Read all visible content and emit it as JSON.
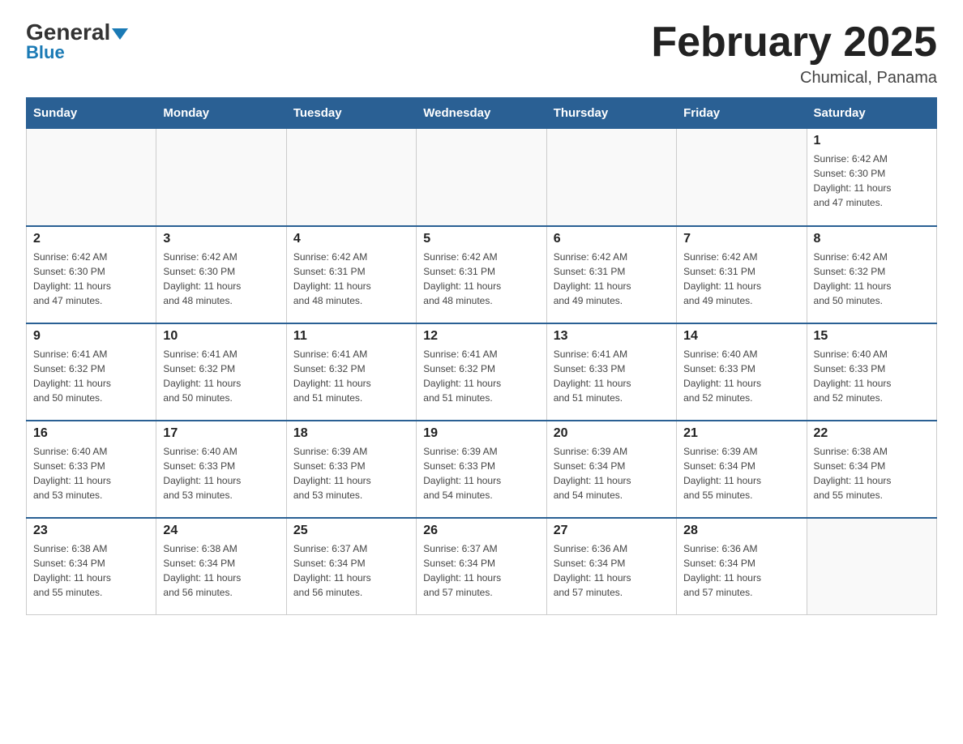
{
  "header": {
    "logo_general": "General",
    "logo_blue": "Blue",
    "month_title": "February 2025",
    "location": "Chumical, Panama"
  },
  "days_of_week": [
    "Sunday",
    "Monday",
    "Tuesday",
    "Wednesday",
    "Thursday",
    "Friday",
    "Saturday"
  ],
  "weeks": [
    [
      {
        "day": "",
        "info": ""
      },
      {
        "day": "",
        "info": ""
      },
      {
        "day": "",
        "info": ""
      },
      {
        "day": "",
        "info": ""
      },
      {
        "day": "",
        "info": ""
      },
      {
        "day": "",
        "info": ""
      },
      {
        "day": "1",
        "info": "Sunrise: 6:42 AM\nSunset: 6:30 PM\nDaylight: 11 hours\nand 47 minutes."
      }
    ],
    [
      {
        "day": "2",
        "info": "Sunrise: 6:42 AM\nSunset: 6:30 PM\nDaylight: 11 hours\nand 47 minutes."
      },
      {
        "day": "3",
        "info": "Sunrise: 6:42 AM\nSunset: 6:30 PM\nDaylight: 11 hours\nand 48 minutes."
      },
      {
        "day": "4",
        "info": "Sunrise: 6:42 AM\nSunset: 6:31 PM\nDaylight: 11 hours\nand 48 minutes."
      },
      {
        "day": "5",
        "info": "Sunrise: 6:42 AM\nSunset: 6:31 PM\nDaylight: 11 hours\nand 48 minutes."
      },
      {
        "day": "6",
        "info": "Sunrise: 6:42 AM\nSunset: 6:31 PM\nDaylight: 11 hours\nand 49 minutes."
      },
      {
        "day": "7",
        "info": "Sunrise: 6:42 AM\nSunset: 6:31 PM\nDaylight: 11 hours\nand 49 minutes."
      },
      {
        "day": "8",
        "info": "Sunrise: 6:42 AM\nSunset: 6:32 PM\nDaylight: 11 hours\nand 50 minutes."
      }
    ],
    [
      {
        "day": "9",
        "info": "Sunrise: 6:41 AM\nSunset: 6:32 PM\nDaylight: 11 hours\nand 50 minutes."
      },
      {
        "day": "10",
        "info": "Sunrise: 6:41 AM\nSunset: 6:32 PM\nDaylight: 11 hours\nand 50 minutes."
      },
      {
        "day": "11",
        "info": "Sunrise: 6:41 AM\nSunset: 6:32 PM\nDaylight: 11 hours\nand 51 minutes."
      },
      {
        "day": "12",
        "info": "Sunrise: 6:41 AM\nSunset: 6:32 PM\nDaylight: 11 hours\nand 51 minutes."
      },
      {
        "day": "13",
        "info": "Sunrise: 6:41 AM\nSunset: 6:33 PM\nDaylight: 11 hours\nand 51 minutes."
      },
      {
        "day": "14",
        "info": "Sunrise: 6:40 AM\nSunset: 6:33 PM\nDaylight: 11 hours\nand 52 minutes."
      },
      {
        "day": "15",
        "info": "Sunrise: 6:40 AM\nSunset: 6:33 PM\nDaylight: 11 hours\nand 52 minutes."
      }
    ],
    [
      {
        "day": "16",
        "info": "Sunrise: 6:40 AM\nSunset: 6:33 PM\nDaylight: 11 hours\nand 53 minutes."
      },
      {
        "day": "17",
        "info": "Sunrise: 6:40 AM\nSunset: 6:33 PM\nDaylight: 11 hours\nand 53 minutes."
      },
      {
        "day": "18",
        "info": "Sunrise: 6:39 AM\nSunset: 6:33 PM\nDaylight: 11 hours\nand 53 minutes."
      },
      {
        "day": "19",
        "info": "Sunrise: 6:39 AM\nSunset: 6:33 PM\nDaylight: 11 hours\nand 54 minutes."
      },
      {
        "day": "20",
        "info": "Sunrise: 6:39 AM\nSunset: 6:34 PM\nDaylight: 11 hours\nand 54 minutes."
      },
      {
        "day": "21",
        "info": "Sunrise: 6:39 AM\nSunset: 6:34 PM\nDaylight: 11 hours\nand 55 minutes."
      },
      {
        "day": "22",
        "info": "Sunrise: 6:38 AM\nSunset: 6:34 PM\nDaylight: 11 hours\nand 55 minutes."
      }
    ],
    [
      {
        "day": "23",
        "info": "Sunrise: 6:38 AM\nSunset: 6:34 PM\nDaylight: 11 hours\nand 55 minutes."
      },
      {
        "day": "24",
        "info": "Sunrise: 6:38 AM\nSunset: 6:34 PM\nDaylight: 11 hours\nand 56 minutes."
      },
      {
        "day": "25",
        "info": "Sunrise: 6:37 AM\nSunset: 6:34 PM\nDaylight: 11 hours\nand 56 minutes."
      },
      {
        "day": "26",
        "info": "Sunrise: 6:37 AM\nSunset: 6:34 PM\nDaylight: 11 hours\nand 57 minutes."
      },
      {
        "day": "27",
        "info": "Sunrise: 6:36 AM\nSunset: 6:34 PM\nDaylight: 11 hours\nand 57 minutes."
      },
      {
        "day": "28",
        "info": "Sunrise: 6:36 AM\nSunset: 6:34 PM\nDaylight: 11 hours\nand 57 minutes."
      },
      {
        "day": "",
        "info": ""
      }
    ]
  ]
}
